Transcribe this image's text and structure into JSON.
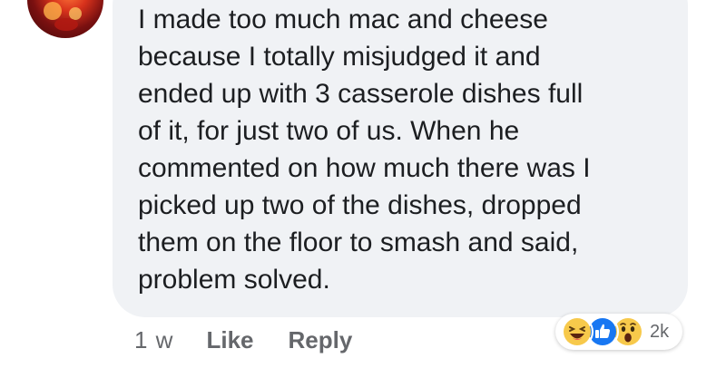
{
  "comment": {
    "text": "I made too much mac and cheese\nbecause I totally misjudged it and\nended up with 3 casserole dishes full\nof it, for just two of us. When he\ncommented on how much there was I\npicked up two of the dishes, dropped\nthem on the floor to smash and said,\nproblem solved."
  },
  "meta": {
    "time": "1 w",
    "like_label": "Like",
    "reply_label": "Reply"
  },
  "reactions": {
    "icons": [
      "laughing-face-icon",
      "like-thumb-icon",
      "wow-face-icon"
    ],
    "count": "2k"
  },
  "colors": {
    "bubble": "#f0f2f5",
    "text": "#1c1e21",
    "meta": "#65676b",
    "like_blue": "#1877f2",
    "emoji_yellow": "#f7c94b"
  }
}
